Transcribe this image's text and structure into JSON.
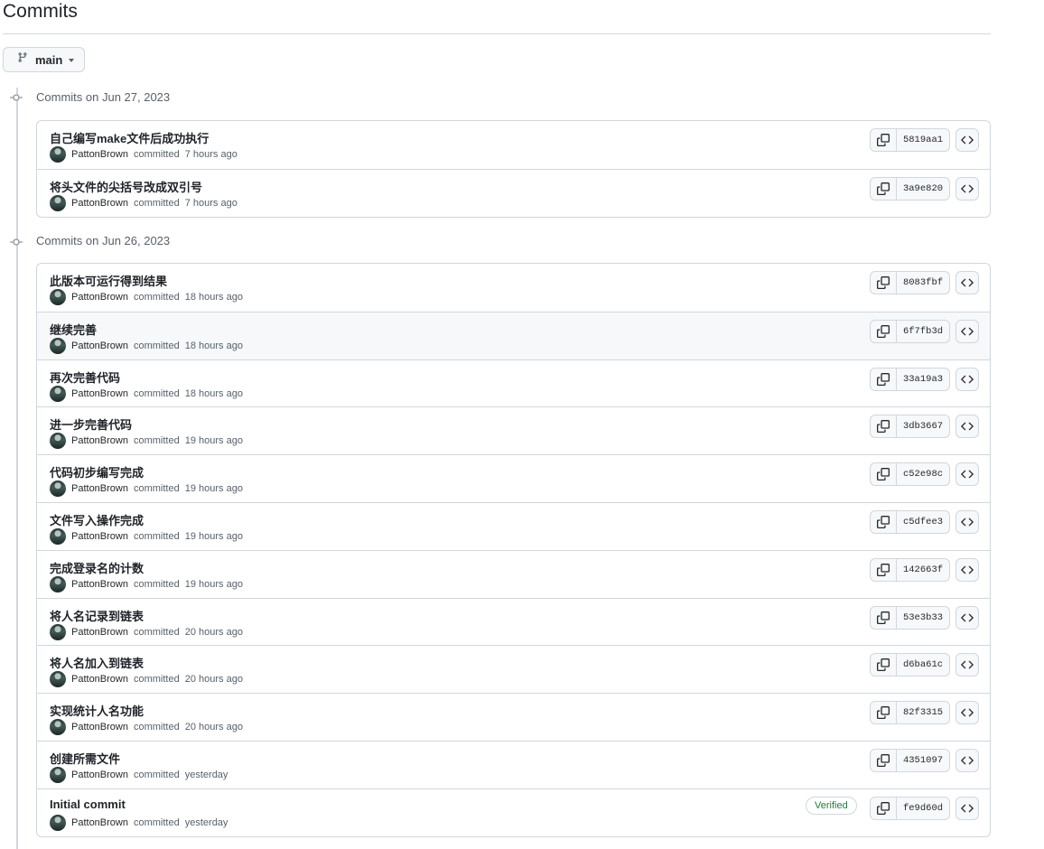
{
  "page": {
    "title": "Commits"
  },
  "branch": {
    "name": "main"
  },
  "groups": [
    {
      "label": "Commits on Jun 27, 2023",
      "commits": [
        {
          "message": "自己编写make文件后成功执行",
          "author": "PattonBrown",
          "action": "committed",
          "time": "7 hours ago",
          "sha": "5819aa1"
        },
        {
          "message": "将头文件的尖括号改成双引号",
          "author": "PattonBrown",
          "action": "committed",
          "time": "7 hours ago",
          "sha": "3a9e820"
        }
      ]
    },
    {
      "label": "Commits on Jun 26, 2023",
      "commits": [
        {
          "message": "此版本可运行得到结果",
          "author": "PattonBrown",
          "action": "committed",
          "time": "18 hours ago",
          "sha": "8083fbf"
        },
        {
          "message": "继续完善",
          "author": "PattonBrown",
          "action": "committed",
          "time": "18 hours ago",
          "sha": "6f7fb3d"
        },
        {
          "message": "再次完善代码",
          "author": "PattonBrown",
          "action": "committed",
          "time": "18 hours ago",
          "sha": "33a19a3"
        },
        {
          "message": "进一步完善代码",
          "author": "PattonBrown",
          "action": "committed",
          "time": "19 hours ago",
          "sha": "3db3667"
        },
        {
          "message": "代码初步编写完成",
          "author": "PattonBrown",
          "action": "committed",
          "time": "19 hours ago",
          "sha": "c52e98c"
        },
        {
          "message": "文件写入操作完成",
          "author": "PattonBrown",
          "action": "committed",
          "time": "19 hours ago",
          "sha": "c5dfee3"
        },
        {
          "message": "完成登录名的计数",
          "author": "PattonBrown",
          "action": "committed",
          "time": "19 hours ago",
          "sha": "142663f"
        },
        {
          "message": "将人名记录到链表",
          "author": "PattonBrown",
          "action": "committed",
          "time": "20 hours ago",
          "sha": "53e3b33"
        },
        {
          "message": "将人名加入到链表",
          "author": "PattonBrown",
          "action": "committed",
          "time": "20 hours ago",
          "sha": "d6ba61c"
        },
        {
          "message": "实现统计人名功能",
          "author": "PattonBrown",
          "action": "committed",
          "time": "20 hours ago",
          "sha": "82f3315"
        },
        {
          "message": "创建所需文件",
          "author": "PattonBrown",
          "action": "committed",
          "time": "yesterday",
          "sha": "4351097"
        },
        {
          "message": "Initial commit",
          "author": "PattonBrown",
          "action": "committed",
          "time": "yesterday",
          "sha": "fe9d60d",
          "badge": "Verified"
        }
      ]
    }
  ],
  "colors": {
    "border": "#d0d7de",
    "muted": "#57606a",
    "verified": "#1a7f37",
    "hover_row": "#f6f8fa"
  },
  "icons": {
    "branch": "git-branch-icon",
    "copy": "copy-icon",
    "browse": "code-icon",
    "timeline": "git-commit-icon"
  }
}
